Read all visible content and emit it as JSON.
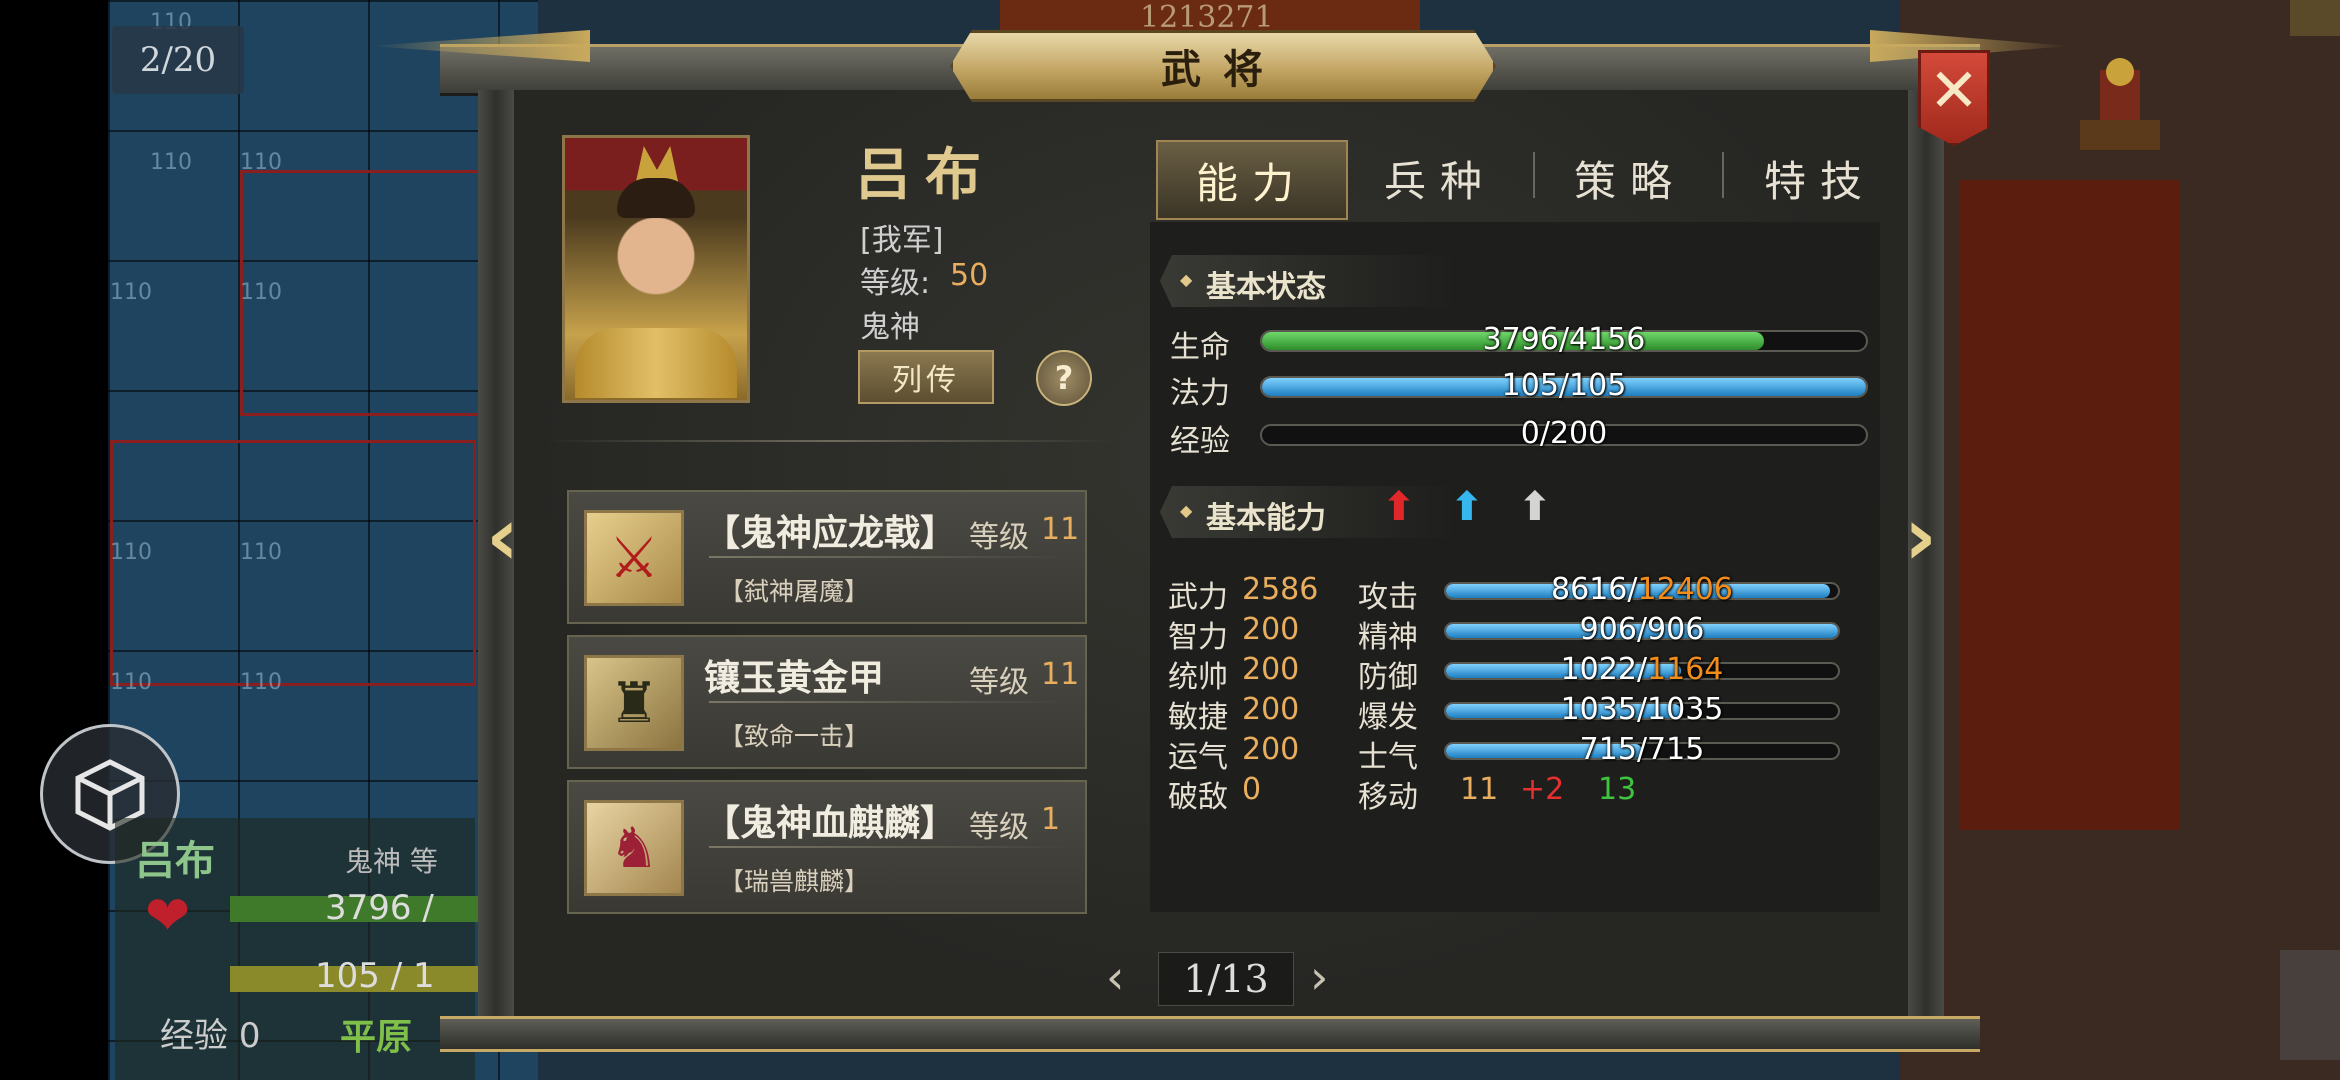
{
  "map": {
    "turn_counter": "2/20",
    "top_number": "1213271",
    "tile_label": "110"
  },
  "unit_panel": {
    "name": "吕布",
    "class_level": "鬼神 等",
    "hp": "3796 /",
    "mp": "105 / 1",
    "exp_label": "经验",
    "exp_value": "0",
    "terrain": "平原"
  },
  "dialog": {
    "title": "武将",
    "close_icon": "close-x-icon"
  },
  "general": {
    "name": "吕布",
    "faction": "[我军]",
    "level_label": "等级:",
    "level_value": "50",
    "class": "鬼神",
    "bio_button": "列传",
    "help_button": "?"
  },
  "equipment": [
    {
      "name": "【鬼神应龙戟】",
      "level_label": "等级",
      "level": "11",
      "skill": "【弑神屠魔】",
      "icon": "halberd-icon"
    },
    {
      "name": "镶玉黄金甲",
      "level_label": "等级",
      "level": "11",
      "skill": "【致命一击】",
      "icon": "armor-icon"
    },
    {
      "name": "【鬼神血麒麟】",
      "level_label": "等级",
      "level": "1",
      "skill": "【瑞兽麒麟】",
      "icon": "qilin-mount-icon"
    }
  ],
  "pager": {
    "current": "1/13",
    "prev": "‹",
    "next": "›"
  },
  "tabs": [
    {
      "label": "能力",
      "active": true
    },
    {
      "label": "兵种",
      "active": false
    },
    {
      "label": "策略",
      "active": false
    },
    {
      "label": "特技",
      "active": false
    }
  ],
  "basic_status": {
    "title": "基本状态",
    "hp": {
      "label": "生命",
      "current": 3796,
      "max": 4156,
      "text": "3796/4156"
    },
    "mp": {
      "label": "法力",
      "current": 105,
      "max": 105,
      "text": "105/105"
    },
    "exp": {
      "label": "经验",
      "current": 0,
      "max": 200,
      "text": "0/200"
    }
  },
  "basic_ability": {
    "title": "基本能力",
    "arrow_icons": [
      "red-up-arrow-icon",
      "blue-up-arrow-icon",
      "gray-up-arrow-icon"
    ],
    "attributes": [
      {
        "label": "武力",
        "value": "2586"
      },
      {
        "label": "智力",
        "value": "200"
      },
      {
        "label": "统帅",
        "value": "200"
      },
      {
        "label": "敏捷",
        "value": "200"
      },
      {
        "label": "运气",
        "value": "200"
      },
      {
        "label": "破敌",
        "value": "0"
      }
    ],
    "stats": [
      {
        "label": "攻击",
        "base": "8616",
        "sep": "/",
        "total": "12406",
        "bonus": true,
        "fill": 0.98
      },
      {
        "label": "精神",
        "base": "906",
        "sep": "/",
        "total": "906",
        "bonus": false,
        "fill": 1.0
      },
      {
        "label": "防御",
        "base": "1022",
        "sep": "/",
        "total": "1164",
        "bonus": true,
        "fill": 0.6
      },
      {
        "label": "爆发",
        "base": "1035",
        "sep": "/",
        "total": "1035",
        "bonus": false,
        "fill": 0.6
      },
      {
        "label": "士气",
        "base": "715",
        "sep": "/",
        "total": "715",
        "bonus": false,
        "fill": 0.5
      }
    ],
    "move": {
      "label": "移动",
      "base": "11",
      "plus": "+2",
      "total": "13"
    }
  },
  "colors": {
    "accent_gold": "#e8ae5e",
    "bonus_orange": "#f28c1a",
    "move_plus_red": "#e63030",
    "move_total_green": "#3ec43e",
    "hp_green": "#4cc247",
    "mp_blue": "#3aa3e6"
  }
}
